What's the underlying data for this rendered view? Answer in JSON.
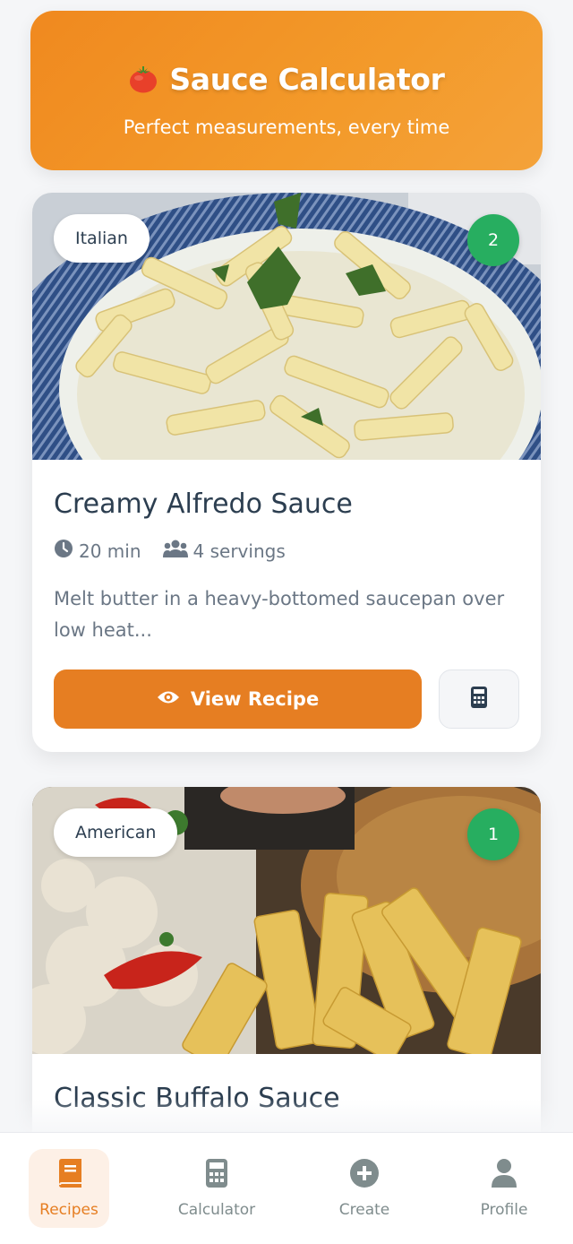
{
  "header": {
    "title": "Sauce Calculator",
    "subtitle": "Perfect measurements, every time",
    "icon": "tomato-icon"
  },
  "recipes": [
    {
      "cuisine": "Italian",
      "count": "2",
      "title": "Creamy Alfredo Sauce",
      "time": "20 min",
      "servings": "4 servings",
      "description": "Melt butter in a heavy-bottomed saucepan over low heat...",
      "view_label": "View Recipe"
    },
    {
      "cuisine": "American",
      "count": "1",
      "title": "Classic Buffalo Sauce"
    }
  ],
  "nav": [
    {
      "label": "Recipes",
      "icon": "book-icon",
      "active": true
    },
    {
      "label": "Calculator",
      "icon": "calculator-icon",
      "active": false
    },
    {
      "label": "Create",
      "icon": "plus-circle-icon",
      "active": false
    },
    {
      "label": "Profile",
      "icon": "user-icon",
      "active": false
    }
  ],
  "colors": {
    "accent": "#e67e22",
    "header_gradient_start": "#f0891f",
    "badge_green": "#27ae60",
    "text_dark": "#2c3e50",
    "text_muted": "#6b7785"
  }
}
